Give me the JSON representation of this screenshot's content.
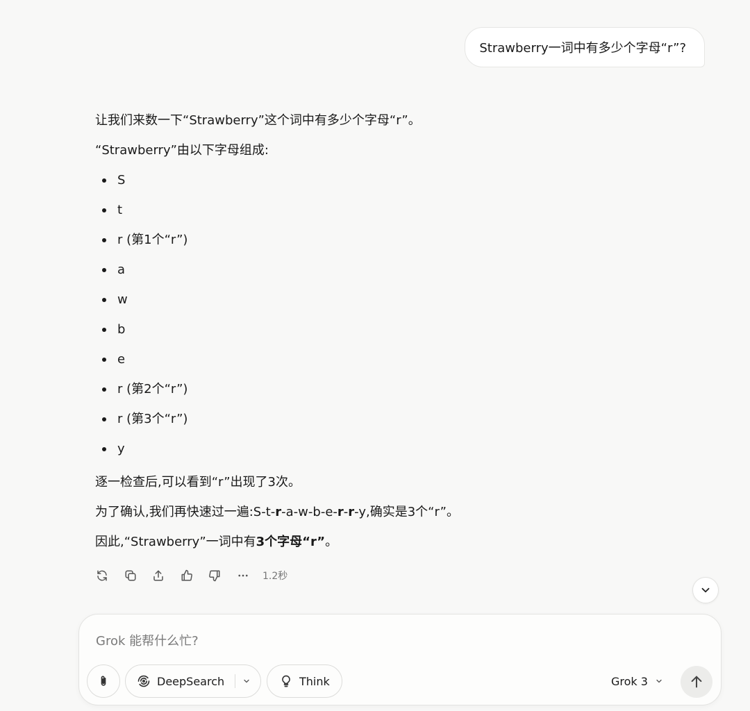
{
  "user_message": {
    "text": "Strawberry一词中有多少个字母“r”?"
  },
  "assistant": {
    "intro": "让我们来数一下“Strawberry”这个词中有多少个字母“r”。",
    "composition_label": "“Strawberry”由以下字母组成:",
    "letters": [
      "S",
      "t",
      "r (第1个“r”)",
      "a",
      "w",
      "b",
      "e",
      "r (第2个“r”)",
      "r (第3个“r”)",
      "y"
    ],
    "check": "逐一检查后,可以看到“r”出现了3次。",
    "confirm_prefix": "为了确认,我们再快速过一遍:S-t-",
    "confirm_r1": "r",
    "confirm_mid": "-a-w-b-e-",
    "confirm_r2": "r",
    "confirm_dash": "-",
    "confirm_r3": "r",
    "confirm_suffix": "-y,确实是3个“r”。",
    "conclusion_prefix": "因此,“Strawberry”一词中有",
    "conclusion_bold": "3个字母“r”",
    "conclusion_suffix": "。"
  },
  "actions": {
    "icons": [
      "regenerate-icon",
      "copy-icon",
      "share-icon",
      "thumbs-up-icon",
      "thumbs-down-icon",
      "more-icon"
    ],
    "elapsed": "1.2秒"
  },
  "composer": {
    "placeholder": "Grok 能帮什么忙?",
    "deepsearch_label": "DeepSearch",
    "think_label": "Think",
    "model_label": "Grok 3"
  }
}
